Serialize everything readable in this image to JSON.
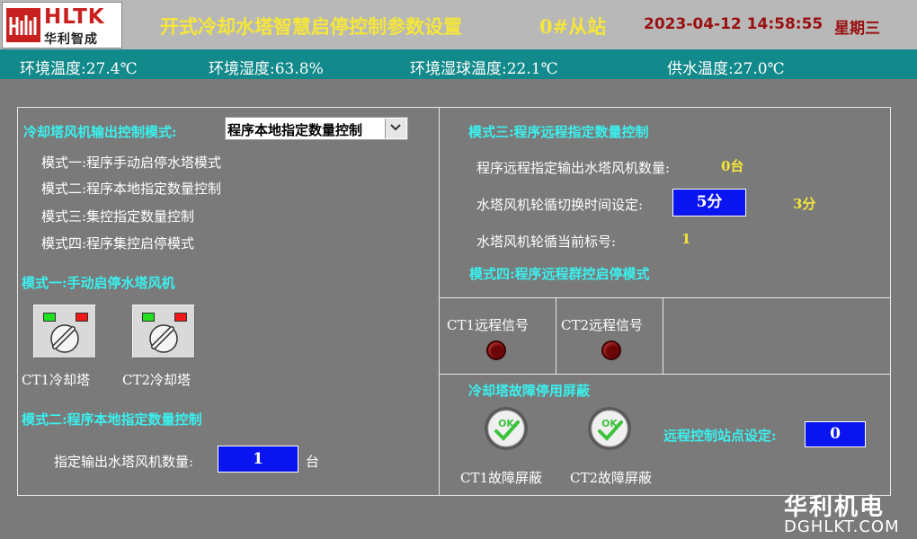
{
  "header": {
    "logo_text": "HLTK",
    "logo_sub": "华利智成",
    "title": "开式冷却水塔智慧启停控制参数设置",
    "station": "0#从站",
    "datetime": "2023-04-12 14:58:55",
    "weekday": "星期三"
  },
  "info_bar": {
    "ambient_temp": "环境温度:27.4℃",
    "ambient_humidity": "环境湿度:63.8%",
    "wet_bulb_temp": "环境湿球温度:22.1℃",
    "supply_temp": "供水温度:27.0℃"
  },
  "left": {
    "control_mode_label": "冷却塔风机输出控制模式:",
    "control_mode_selected": "程序本地指定数量控制",
    "mode_list": [
      "模式一:程序手动启停水塔模式",
      "模式二:程序本地指定数量控制",
      "模式三:集控指定数量控制",
      "模式四:程序集控启停模式"
    ],
    "mode1_title": "模式一:手动启停水塔风机",
    "switches": [
      {
        "label": "CT1冷却塔"
      },
      {
        "label": "CT2冷却塔"
      }
    ],
    "mode2_title": "模式二:程序本地指定数量控制",
    "fan_count_label": "指定输出水塔风机数量:",
    "fan_count_value": "1",
    "fan_count_unit": "台"
  },
  "right": {
    "mode3_title": "模式三:程序远程指定数量控制",
    "remote_count_label": "程序远程指定输出水塔风机数量:",
    "remote_count_value": "0台",
    "cycle_time_label": "水塔风机轮循切换时间设定:",
    "cycle_time_setpoint": "5分",
    "cycle_time_current": "3分",
    "cycle_index_label": "水塔风机轮循当前标号:",
    "cycle_index_value": "1",
    "mode4_title": "模式四:程序远程群控启停模式",
    "signals": [
      {
        "label": "CT1远程信号"
      },
      {
        "label": "CT2远程信号"
      }
    ],
    "fault_title": "冷却塔故障停用屏蔽",
    "fault_buttons": [
      {
        "label": "CT1故障屏蔽",
        "icon_text": "OK"
      },
      {
        "label": "CT2故障屏蔽",
        "icon_text": "OK"
      }
    ],
    "station_label": "远程控制站点设定:",
    "station_value": "0"
  },
  "watermark": {
    "line1": "华利机电",
    "line2": "DGHLKT.COM"
  },
  "colors": {
    "background": "#7a7a7a",
    "header": "#b8b8b8",
    "info_bar": "#12898a",
    "title_yellow": "#f5e63a",
    "datetime_red": "#9a1010",
    "section_cyan": "#3af0ee",
    "input_blue": "#0a14f0"
  }
}
